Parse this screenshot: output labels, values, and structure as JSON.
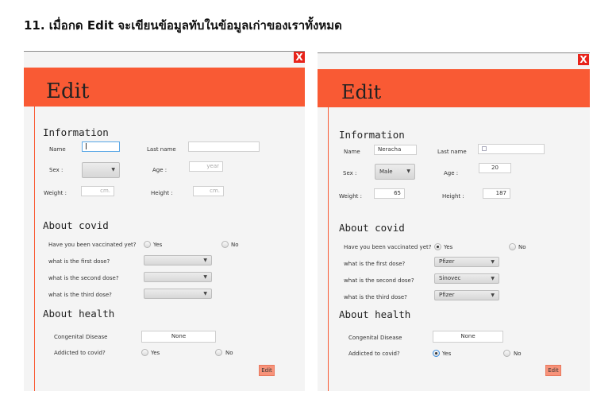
{
  "heading": "11. เมื่อกด Edit จะเขียนข้อมูลทับในข้อมูลเก่าของเราทั้งหมด",
  "close_glyph": "X",
  "left": {
    "title": "Edit",
    "section_information": "Information",
    "name_label": "Name",
    "lastname_label": "Last name",
    "name_value": "",
    "lastname_value": "",
    "sex_label": "Sex   :",
    "sex_value": "",
    "age_label": "Age   :",
    "age_placeholder": "year",
    "weight_label": "Weight  :",
    "weight_placeholder": "cm.",
    "height_label": "Height    :",
    "height_placeholder": "cm.",
    "section_covid": "About covid",
    "vaccinated_q": "Have you been vaccinated yet?",
    "yes": "Yes",
    "no": "No",
    "first_dose_q": "what is the first dose?",
    "second_dose_q": "what is the second dose?",
    "third_dose_q": "what is the third dose?",
    "first_dose_value": "",
    "second_dose_value": "",
    "third_dose_value": "",
    "section_health": "About health",
    "congenital_label": "Congenital Disease",
    "congenital_value": "None",
    "addicted_q": "Addicted to covid?",
    "edit_button": "Edit"
  },
  "right": {
    "title": "Edit",
    "section_information": "Information",
    "name_label": "Name",
    "lastname_label": "Last name",
    "name_value": "Neracha",
    "lastname_value": "",
    "sex_label": "Sex   :",
    "sex_value": "Male",
    "age_label": "Age   :",
    "age_value": "20",
    "weight_label": "Weight  :",
    "weight_value": "65",
    "height_label": "Height    :",
    "height_value": "187",
    "section_covid": "About covid",
    "vaccinated_q": "Have you been vaccinated yet?",
    "yes": "Yes",
    "no": "No",
    "first_dose_q": "what is the first dose?",
    "second_dose_q": "what is the second dose?",
    "third_dose_q": "what is the third dose?",
    "first_dose_value": "Pfizer",
    "second_dose_value": "Sinovec",
    "third_dose_value": "Pfizer",
    "section_health": "About health",
    "congenital_label": "Congenital Disease",
    "congenital_value": "None",
    "addicted_q": "Addicted to covid?",
    "edit_button": "Edit"
  },
  "colors": {
    "banner": "#f95a34",
    "close": "#e8231a",
    "button": "#f8937a"
  },
  "icons": {
    "close": "close-icon",
    "dropdown": "chevron-down-icon"
  }
}
